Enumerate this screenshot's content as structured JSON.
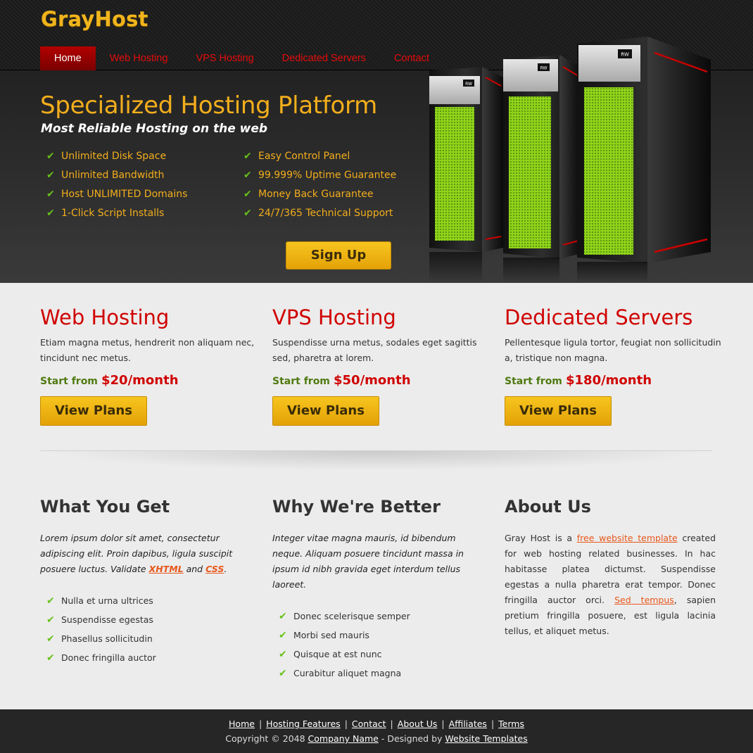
{
  "brand": {
    "logo": "GrayHost"
  },
  "nav": {
    "items": [
      {
        "label": "Home"
      },
      {
        "label": "Web Hosting"
      },
      {
        "label": "VPS Hosting"
      },
      {
        "label": "Dedicated Servers"
      },
      {
        "label": "Contact"
      }
    ],
    "active": "Home"
  },
  "hero": {
    "title": "Specialized Hosting Platform",
    "subtitle": "Most Reliable Hosting on the web",
    "features": [
      "Unlimited Disk Space",
      "Easy Control Panel",
      "Unlimited Bandwidth",
      "99.999% Uptime Guarantee",
      "Host UNLIMITED Domains",
      "Money Back Guarantee",
      "1-Click Script Installs",
      "24/7/365 Technical Support"
    ],
    "signup_label": "Sign Up",
    "server_badge": "RW"
  },
  "plans": [
    {
      "title": "Web Hosting",
      "desc": "Etiam magna metus, hendrerit non aliquam nec, tincidunt nec metus.",
      "price_label": "Start from",
      "price": "$20/month",
      "button": "View Plans"
    },
    {
      "title": "VPS Hosting",
      "desc": "Suspendisse urna metus, sodales eget sagittis sed, pharetra at lorem.",
      "price_label": "Start from",
      "price": "$50/month",
      "button": "View Plans"
    },
    {
      "title": "Dedicated Servers",
      "desc": "Pellentesque ligula tortor, feugiat non sollicitudin a, tristique non magna.",
      "price_label": "Start from",
      "price": "$180/month",
      "button": "View Plans"
    }
  ],
  "what_you_get": {
    "title": "What You Get",
    "intro_1": "Lorem ipsum dolor sit amet, consectetur adipiscing elit. Proin dapibus, ligula suscipit posuere luctus. Validate ",
    "link_xhtml": "XHTML",
    "intro_and": " and ",
    "link_css": "CSS",
    "intro_end": ".",
    "items": [
      "Nulla et urna ultrices",
      "Suspendisse egestas",
      "Phasellus sollicitudin",
      "Donec fringilla auctor"
    ]
  },
  "why_better": {
    "title": "Why We're Better",
    "intro": "Integer vitae magna mauris, id bibendum neque. Aliquam posuere tincidunt massa in ipsum id nibh gravida eget interdum tellus laoreet.",
    "items": [
      "Donec scelerisque semper",
      "Morbi sed mauris",
      "Quisque at est nunc",
      "Curabitur aliquet magna"
    ]
  },
  "about": {
    "title": "About Us",
    "text_1": "Gray Host is a ",
    "link_1": "free website template",
    "text_2": " created for web hosting related businesses. In hac habitasse platea dictumst. Suspendisse egestas a nulla pharetra erat tempor. Donec fringilla auctor orci. ",
    "link_2": "Sed tempus",
    "text_3": ", sapien pretium fringilla posuere, est ligula lacinia tellus, et aliquet metus."
  },
  "footer": {
    "links": [
      "Home",
      "Hosting Features",
      "Contact",
      "About Us",
      "Affiliates",
      "Terms"
    ],
    "copyright_pre": "Copyright © 2048 ",
    "company": "Company Name",
    "designed_by": " - Designed by ",
    "templates": "Website Templates"
  },
  "colors": {
    "accent": "#f3ae1c",
    "red": "#d00000",
    "green": "#66c21a",
    "price_label": "#4f7a10",
    "link": "#e8571b",
    "server_mesh": "#8fd41a"
  },
  "icons": {
    "check": "check-icon"
  }
}
